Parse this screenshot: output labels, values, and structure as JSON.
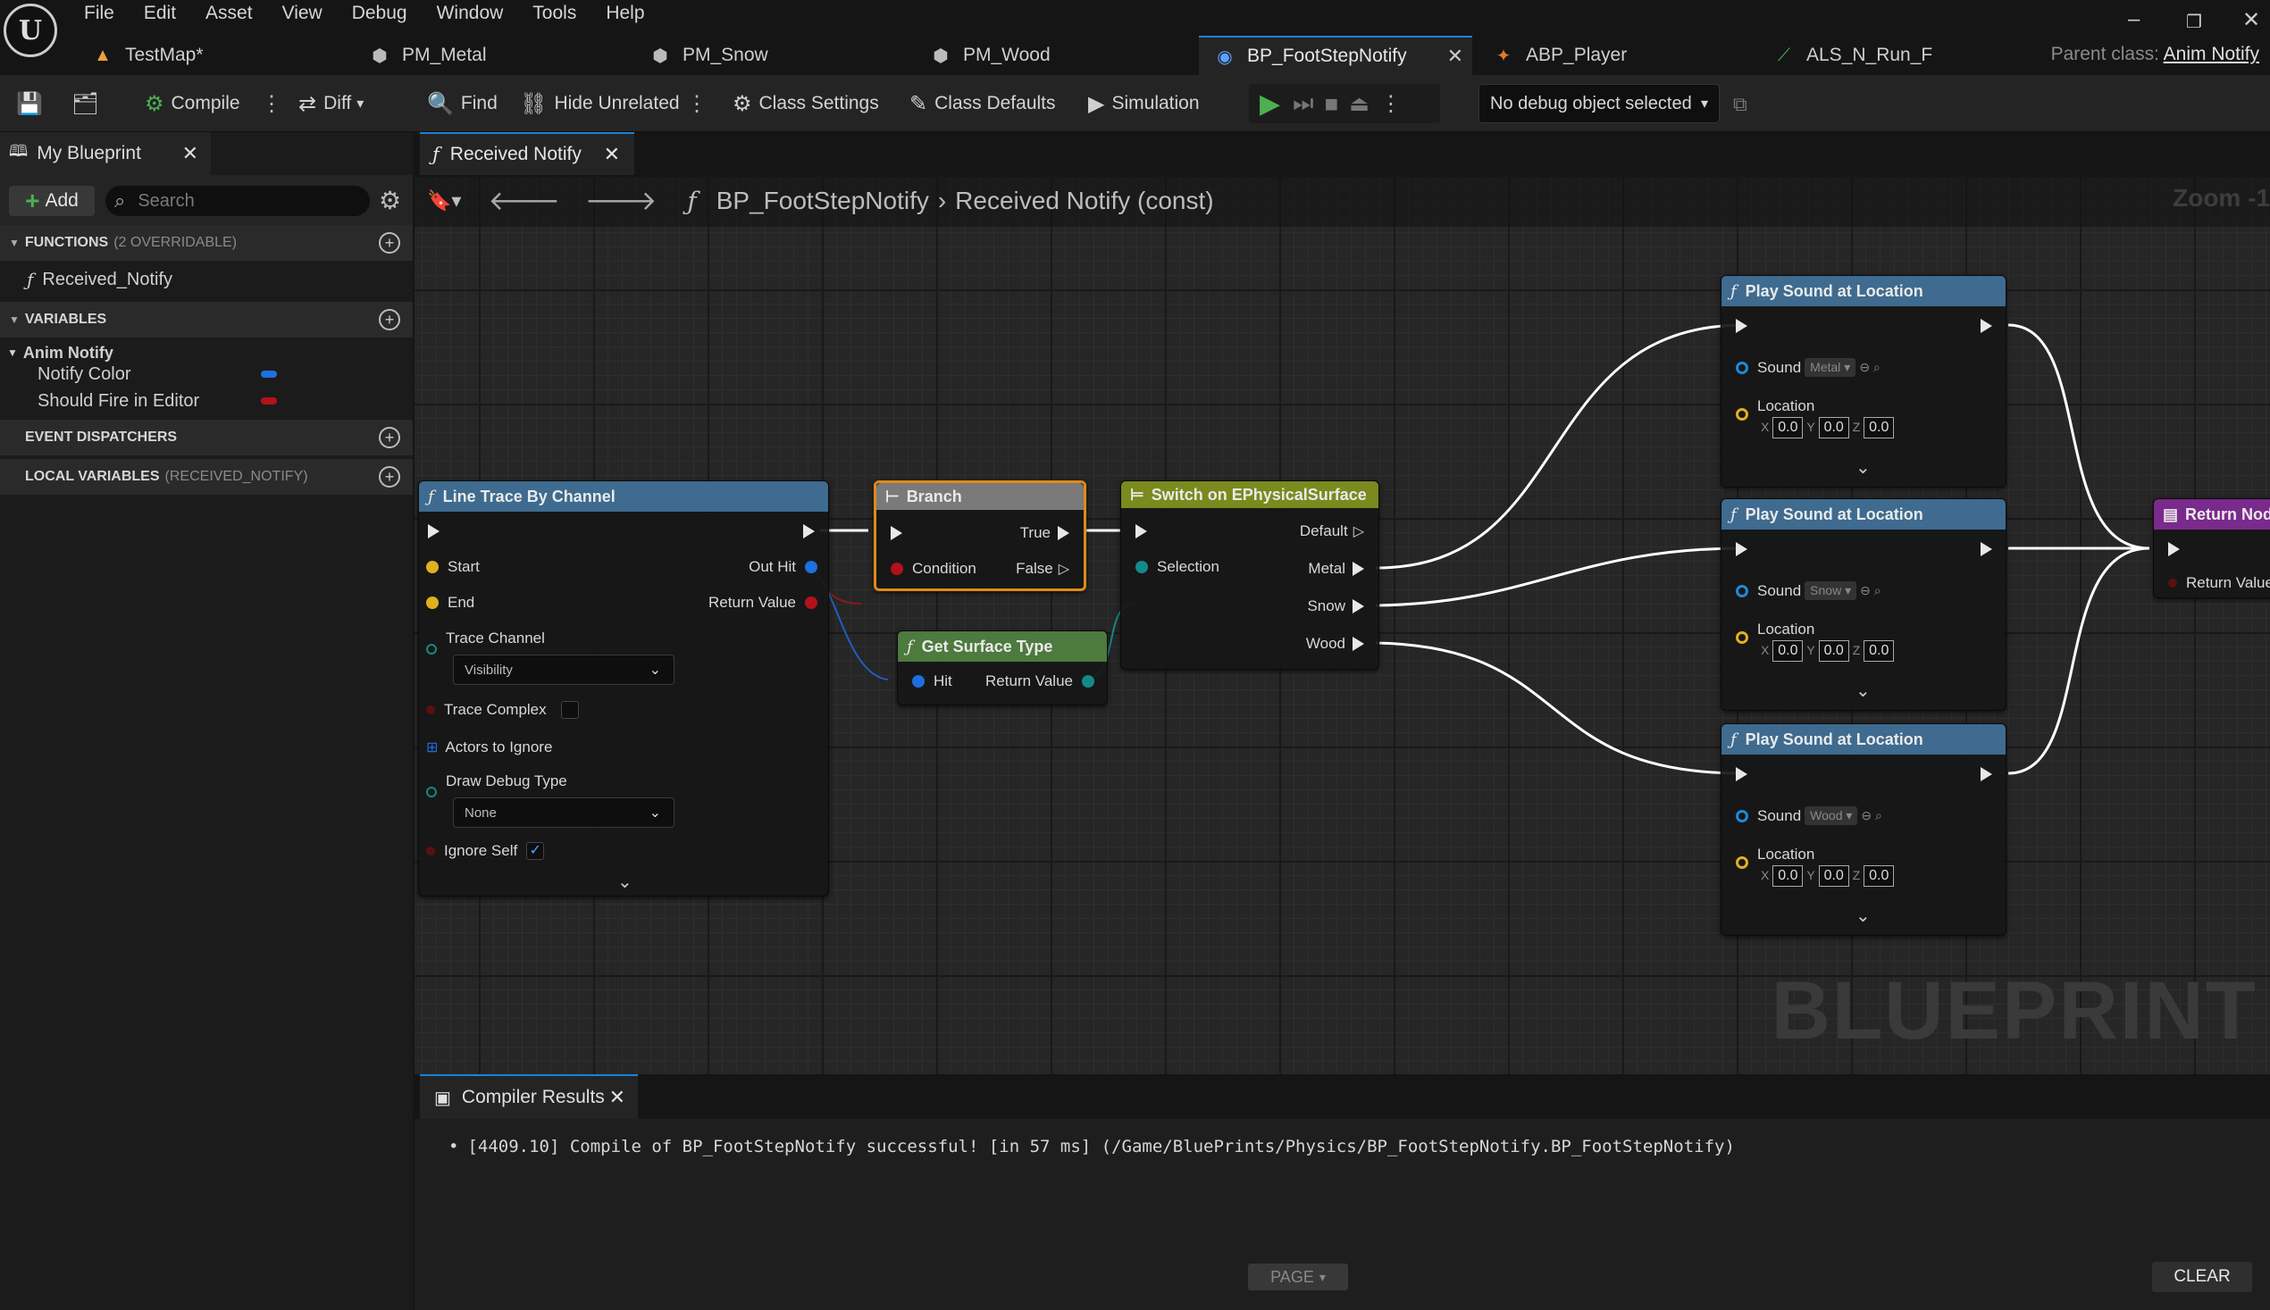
{
  "menu": {
    "logo": "U",
    "items": [
      "File",
      "Edit",
      "Asset",
      "View",
      "Debug",
      "Window",
      "Tools",
      "Help"
    ]
  },
  "tabs": [
    {
      "label": "TestMap*",
      "icon": "map-icon"
    },
    {
      "label": "PM_Metal",
      "icon": "physical-material-icon"
    },
    {
      "label": "PM_Snow",
      "icon": "physical-material-icon"
    },
    {
      "label": "PM_Wood",
      "icon": "physical-material-icon"
    },
    {
      "label": "BP_FootStepNotify",
      "icon": "blueprint-icon",
      "active": true
    },
    {
      "label": "ABP_Player",
      "icon": "anim-blueprint-icon"
    },
    {
      "label": "ALS_N_Run_F",
      "icon": "animation-sequence-icon"
    }
  ],
  "parent_class": {
    "label": "Parent class:",
    "value": "Anim Notify"
  },
  "toolbar": {
    "compile": "Compile",
    "diff": "Diff",
    "find": "Find",
    "hide_unrelated": "Hide Unrelated",
    "class_settings": "Class Settings",
    "class_defaults": "Class Defaults",
    "simulation": "Simulation",
    "debug_object": "No debug object selected"
  },
  "my_blueprint": {
    "tab": "My Blueprint",
    "add": "Add",
    "search_placeholder": "Search",
    "functions": {
      "label": "FUNCTIONS",
      "extra": "(2 OVERRIDABLE)",
      "items": [
        "Received_Notify"
      ]
    },
    "variables": {
      "label": "VARIABLES",
      "category": "Anim Notify",
      "items": [
        {
          "name": "Notify Color",
          "color": "#1f6fe0"
        },
        {
          "name": "Should Fire in Editor",
          "color": "#b3121a"
        }
      ]
    },
    "event_dispatchers": {
      "label": "EVENT DISPATCHERS"
    },
    "local_variables": {
      "label": "LOCAL VARIABLES",
      "extra": "(RECEIVED_NOTIFY)"
    }
  },
  "graph": {
    "tab": "Received Notify",
    "breadcrumb": {
      "blueprint": "BP_FootStepNotify",
      "function": "Received Notify (const)"
    },
    "zoom": "Zoom -1",
    "watermark": "BLUEPRINT",
    "nodes": {
      "line_trace": {
        "title": "Line Trace By Channel",
        "start": "Start",
        "end": "End",
        "trace_channel": "Trace Channel",
        "trace_channel_value": "Visibility",
        "trace_complex": "Trace Complex",
        "actors_to_ignore": "Actors to Ignore",
        "draw_debug_type": "Draw Debug Type",
        "draw_debug_value": "None",
        "ignore_self": "Ignore Self",
        "ignore_self_checked": true,
        "out_hit": "Out Hit",
        "return_value": "Return Value"
      },
      "branch": {
        "title": "Branch",
        "true": "True",
        "condition": "Condition",
        "false": "False"
      },
      "get_surface": {
        "title": "Get Surface Type",
        "hit": "Hit",
        "return_value": "Return Value"
      },
      "switch": {
        "title": "Switch on EPhysicalSurface",
        "selection": "Selection",
        "default": "Default",
        "metal": "Metal",
        "snow": "Snow",
        "wood": "Wood"
      },
      "play_sounds": [
        {
          "title": "Play Sound at Location",
          "sound": "Sound",
          "sound_asset": "Metal",
          "location": "Location",
          "x": "0.0",
          "y": "0.0",
          "z": "0.0"
        },
        {
          "title": "Play Sound at Location",
          "sound": "Sound",
          "sound_asset": "Snow",
          "location": "Location",
          "x": "0.0",
          "y": "0.0",
          "z": "0.0"
        },
        {
          "title": "Play Sound at Location",
          "sound": "Sound",
          "sound_asset": "Wood",
          "location": "Location",
          "x": "0.0",
          "y": "0.0",
          "z": "0.0"
        }
      ],
      "return_node": {
        "title": "Return Node",
        "return_value": "Return Value"
      }
    }
  },
  "compiler": {
    "tab": "Compiler Results",
    "message": "[4409.10] Compile of BP_FootStepNotify successful! [in 57 ms] (/Game/BluePrints/Physics/BP_FootStepNotify.BP_FootStepNotify)",
    "page": "PAGE",
    "clear": "CLEAR"
  },
  "colors": {
    "accent": "#1b82d8",
    "function_header": "#3e6b8f",
    "switch_header": "#7a8a1e",
    "pure_header": "#4d7a3e",
    "return_header": "#7a2a8c",
    "branch_border": "#e08a18"
  }
}
